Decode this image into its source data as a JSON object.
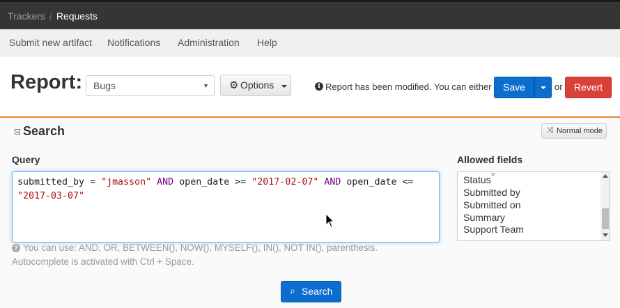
{
  "breadcrumb": {
    "items": [
      "Trackers",
      "Requests"
    ],
    "separator": "/"
  },
  "nav": {
    "items": [
      "Submit new artifact",
      "Notifications",
      "Administration",
      "Help"
    ]
  },
  "report": {
    "label": "Report:",
    "selected": "Bugs",
    "options_label": "Options",
    "modified_msg": "Report has been modified. You can either",
    "save_label": "Save",
    "or_label": "or",
    "revert_label": "Revert"
  },
  "search": {
    "title": "Search",
    "mode_label": "Normal mode",
    "query_label": "Query",
    "query_line1": [
      {
        "t": "submitted_by = ",
        "c": "plain"
      },
      {
        "t": "\"jmasson\"",
        "c": "str"
      },
      {
        "t": " ",
        "c": "plain"
      },
      {
        "t": "AND",
        "c": "kw"
      },
      {
        "t": " open_date >= ",
        "c": "plain"
      },
      {
        "t": "\"2017-02-07\"",
        "c": "str"
      },
      {
        "t": " ",
        "c": "plain"
      },
      {
        "t": "AND",
        "c": "kw"
      },
      {
        "t": " open_date <=",
        "c": "plain"
      }
    ],
    "query_line2": [
      {
        "t": "\"2017-03-07\"",
        "c": "str"
      }
    ],
    "help_line1": "You can use: AND, OR, BETWEEN(), NOW(), MYSELF(), IN(), NOT IN(), parenthesis.",
    "help_line2": "Autocomplete is activated with Ctrl + Space.",
    "allowed_label": "Allowed fields",
    "allowed_fields": [
      "Status",
      "Submitted by",
      "Submitted on",
      "Summary",
      "Support Team"
    ],
    "search_button": "Search"
  },
  "colors": {
    "primary": "#0b6ecf",
    "danger": "#d9403a",
    "accent": "#e8862a",
    "topbar": "#353535"
  },
  "icons": [
    "gear-icon",
    "info-icon",
    "caret-down-icon",
    "collapse-icon",
    "shuffle-icon",
    "question-icon",
    "search-icon",
    "mouse-cursor-icon"
  ]
}
